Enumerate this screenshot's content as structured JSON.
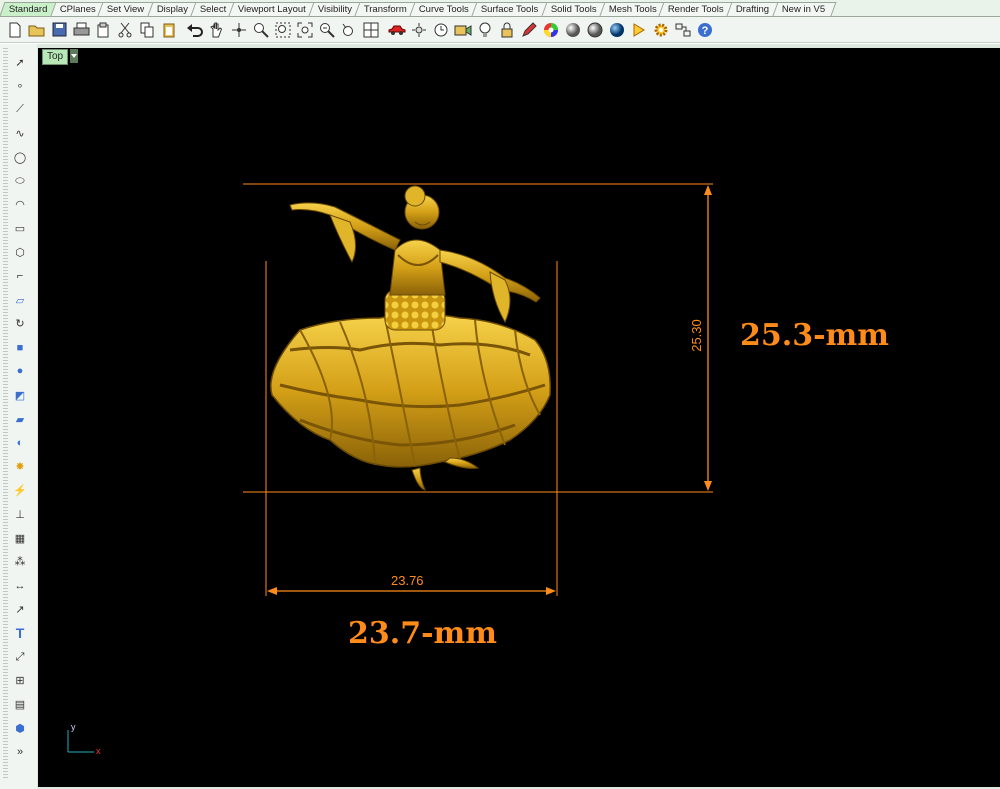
{
  "tabs": [
    {
      "label": "Standard",
      "active": true
    },
    {
      "label": "CPlanes"
    },
    {
      "label": "Set View"
    },
    {
      "label": "Display"
    },
    {
      "label": "Select"
    },
    {
      "label": "Viewport Layout"
    },
    {
      "label": "Visibility"
    },
    {
      "label": "Transform"
    },
    {
      "label": "Curve Tools"
    },
    {
      "label": "Surface Tools"
    },
    {
      "label": "Solid Tools"
    },
    {
      "label": "Mesh Tools"
    },
    {
      "label": "Render Tools"
    },
    {
      "label": "Drafting"
    },
    {
      "label": "New in V5"
    }
  ],
  "toolbar_icons": [
    "new-icon",
    "open-icon",
    "save-icon",
    "print-icon",
    "import-icon",
    "cut-icon",
    "copy-icon",
    "paste-icon",
    "undo-icon",
    "pan-icon",
    "rotate-view-icon",
    "zoom-dynamic-icon",
    "zoom-window-icon",
    "zoom-extents-icon",
    "zoom-selected-icon",
    "undo-view-icon",
    "four-viewports-icon",
    "car-icon",
    "sun-icon",
    "clock-icon",
    "camera-icon",
    "bulb-icon",
    "lock-icon",
    "pencil-icon",
    "color-wheel-icon",
    "shaded-sphere-icon",
    "render-sphere-icon",
    "rendered-icon",
    "flamingo-icon",
    "settings-icon",
    "layout-icon",
    "help-icon"
  ],
  "left_icons": [
    "select-arrow-icon",
    "point-icon",
    "polyline-icon",
    "curve-icon",
    "circle-icon",
    "ellipse-icon",
    "arc-icon",
    "rectangle-icon",
    "polygon-icon",
    "fillet-icon",
    "surface-icon",
    "revolve-icon",
    "box-icon",
    "spheres-icon",
    "extrude-icon",
    "plane-icon",
    "boolean-icon",
    "explode-icon",
    "split-icon",
    "cap-icon",
    "mesh-icon",
    "group-icon",
    "dimension-icon",
    "leader-icon",
    "text-icon",
    "transform-icon",
    "array-icon",
    "layer-icon",
    "cube-icon",
    "more-icon"
  ],
  "viewport": {
    "title": "Top",
    "dim_horizontal": "23.76",
    "dim_vertical": "25.30",
    "label_width": "23.7-mm",
    "label_height": "25.3-mm",
    "axis_x": "x",
    "axis_y": "y"
  },
  "colors": {
    "dimension": "#ff8c1a",
    "viewport_bg": "#000000",
    "gold": "#d4a017"
  }
}
